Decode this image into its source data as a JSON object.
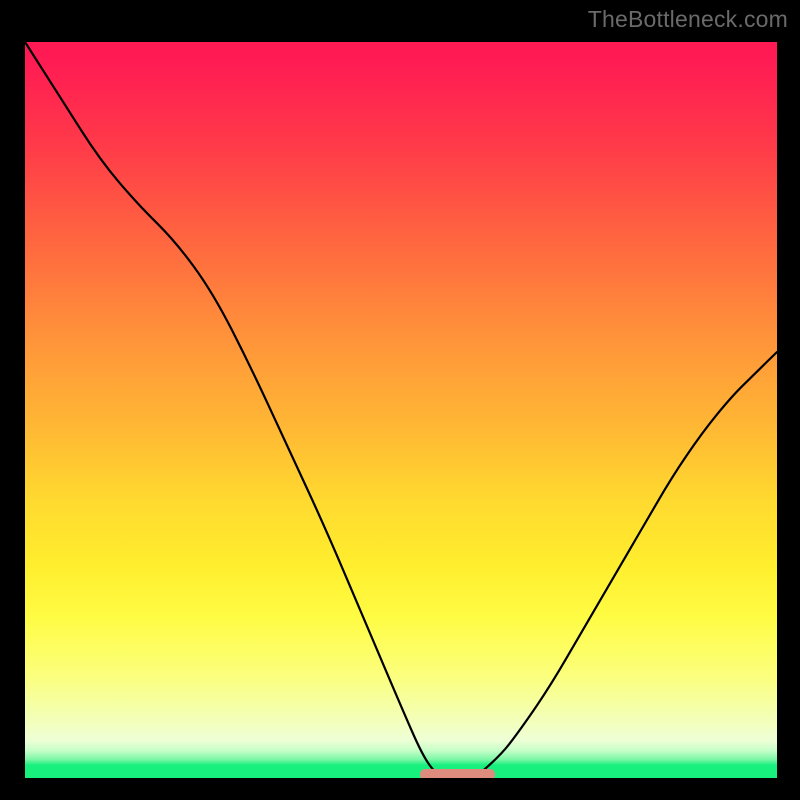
{
  "watermark": "TheBottleneck.com",
  "chart_data": {
    "type": "line",
    "title": "",
    "xlabel": "",
    "ylabel": "",
    "xlim": [
      0,
      100
    ],
    "ylim": [
      0,
      100
    ],
    "grid": false,
    "background_gradient": {
      "top": "#ff1a54",
      "mid1": "#ff933a",
      "mid2": "#ffee2e",
      "bottom": "#18f07e"
    },
    "left_curve": {
      "note": "descends from top-left, concave, reaching near zero around x≈55",
      "x": [
        0,
        5,
        10,
        15,
        20,
        25,
        30,
        35,
        40,
        45,
        50,
        53,
        55
      ],
      "y": [
        100,
        92,
        84,
        78,
        73,
        66,
        56,
        45,
        34,
        22,
        10,
        3,
        0.5
      ]
    },
    "right_curve": {
      "note": "rises from near zero around x≈60 toward upper right, ends ~y=58 at x=100",
      "x": [
        60,
        63,
        66,
        70,
        74,
        78,
        82,
        86,
        90,
        94,
        97,
        100
      ],
      "y": [
        0.5,
        3,
        7,
        13,
        20,
        27,
        34,
        41,
        47,
        52,
        55,
        58
      ]
    },
    "marker": {
      "x_start": 52.5,
      "x_end": 62.5,
      "color": "#dd8c7e"
    }
  }
}
